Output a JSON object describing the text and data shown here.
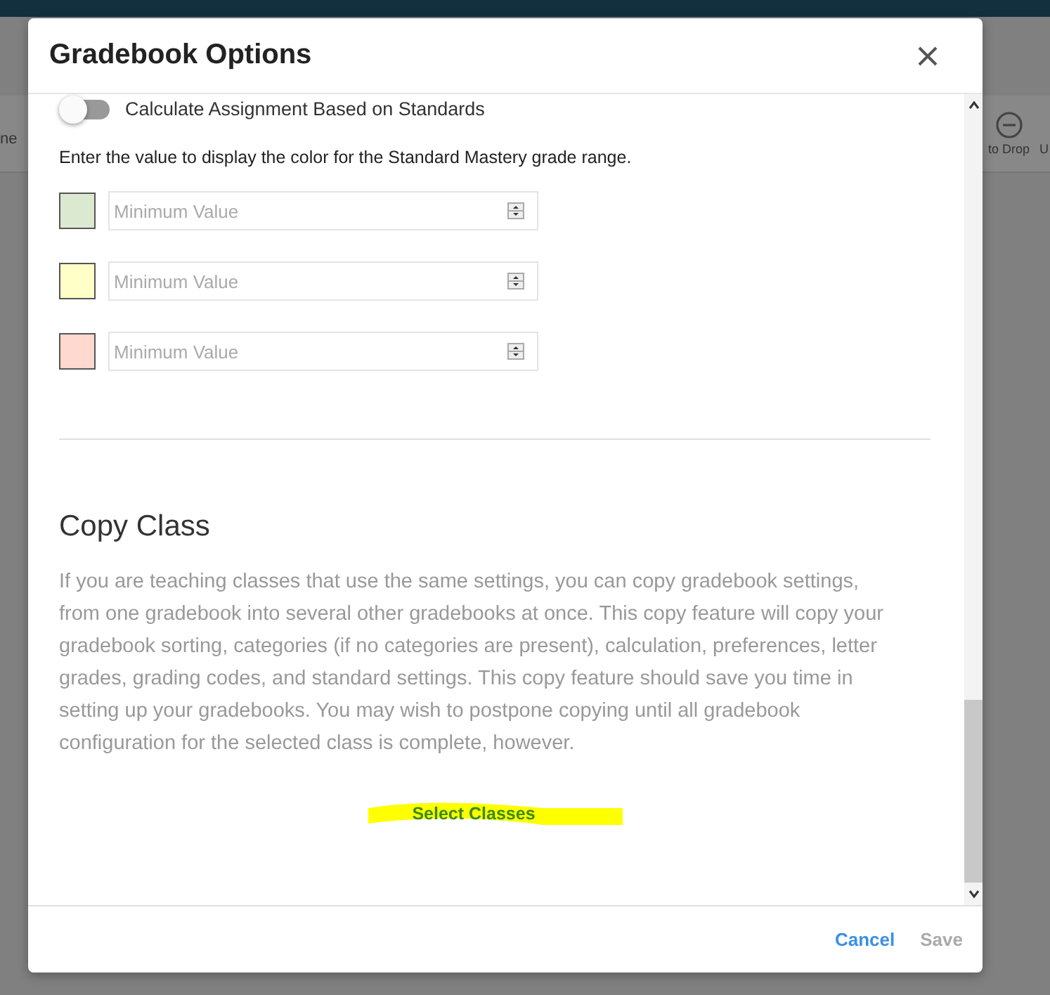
{
  "background": {
    "left_text": "ne",
    "toolbar_item": "to Drop",
    "right_text": "U"
  },
  "dialog": {
    "title": "Gradebook Options",
    "toggle": {
      "label": "Calculate Assignment Based on Standards",
      "on": false
    },
    "instruction": "Enter the value to display the color for the Standard Mastery grade range.",
    "ranges": [
      {
        "color": "#dbe9d0",
        "placeholder": "Minimum Value"
      },
      {
        "color": "#ffffc8",
        "placeholder": "Minimum Value"
      },
      {
        "color": "#fdd9d0",
        "placeholder": "Minimum Value"
      }
    ],
    "copy_class": {
      "heading": "Copy Class",
      "description": "If you are teaching classes that use the same settings, you can copy gradebook settings, from one gradebook into several other gradebooks at once. This copy feature will copy your gradebook sorting, categories (if no categories are present), calculation, preferences, letter grades, grading codes, and standard settings. This copy feature should save you time in setting up your gradebooks. You may wish to postpone copying until all gradebook configuration for the selected class is complete, however.",
      "link": "Select Classes",
      "highlighted": true
    },
    "buttons": [
      {
        "label": "Cancel",
        "disabled": false
      },
      {
        "label": "Save",
        "disabled": true
      }
    ]
  }
}
